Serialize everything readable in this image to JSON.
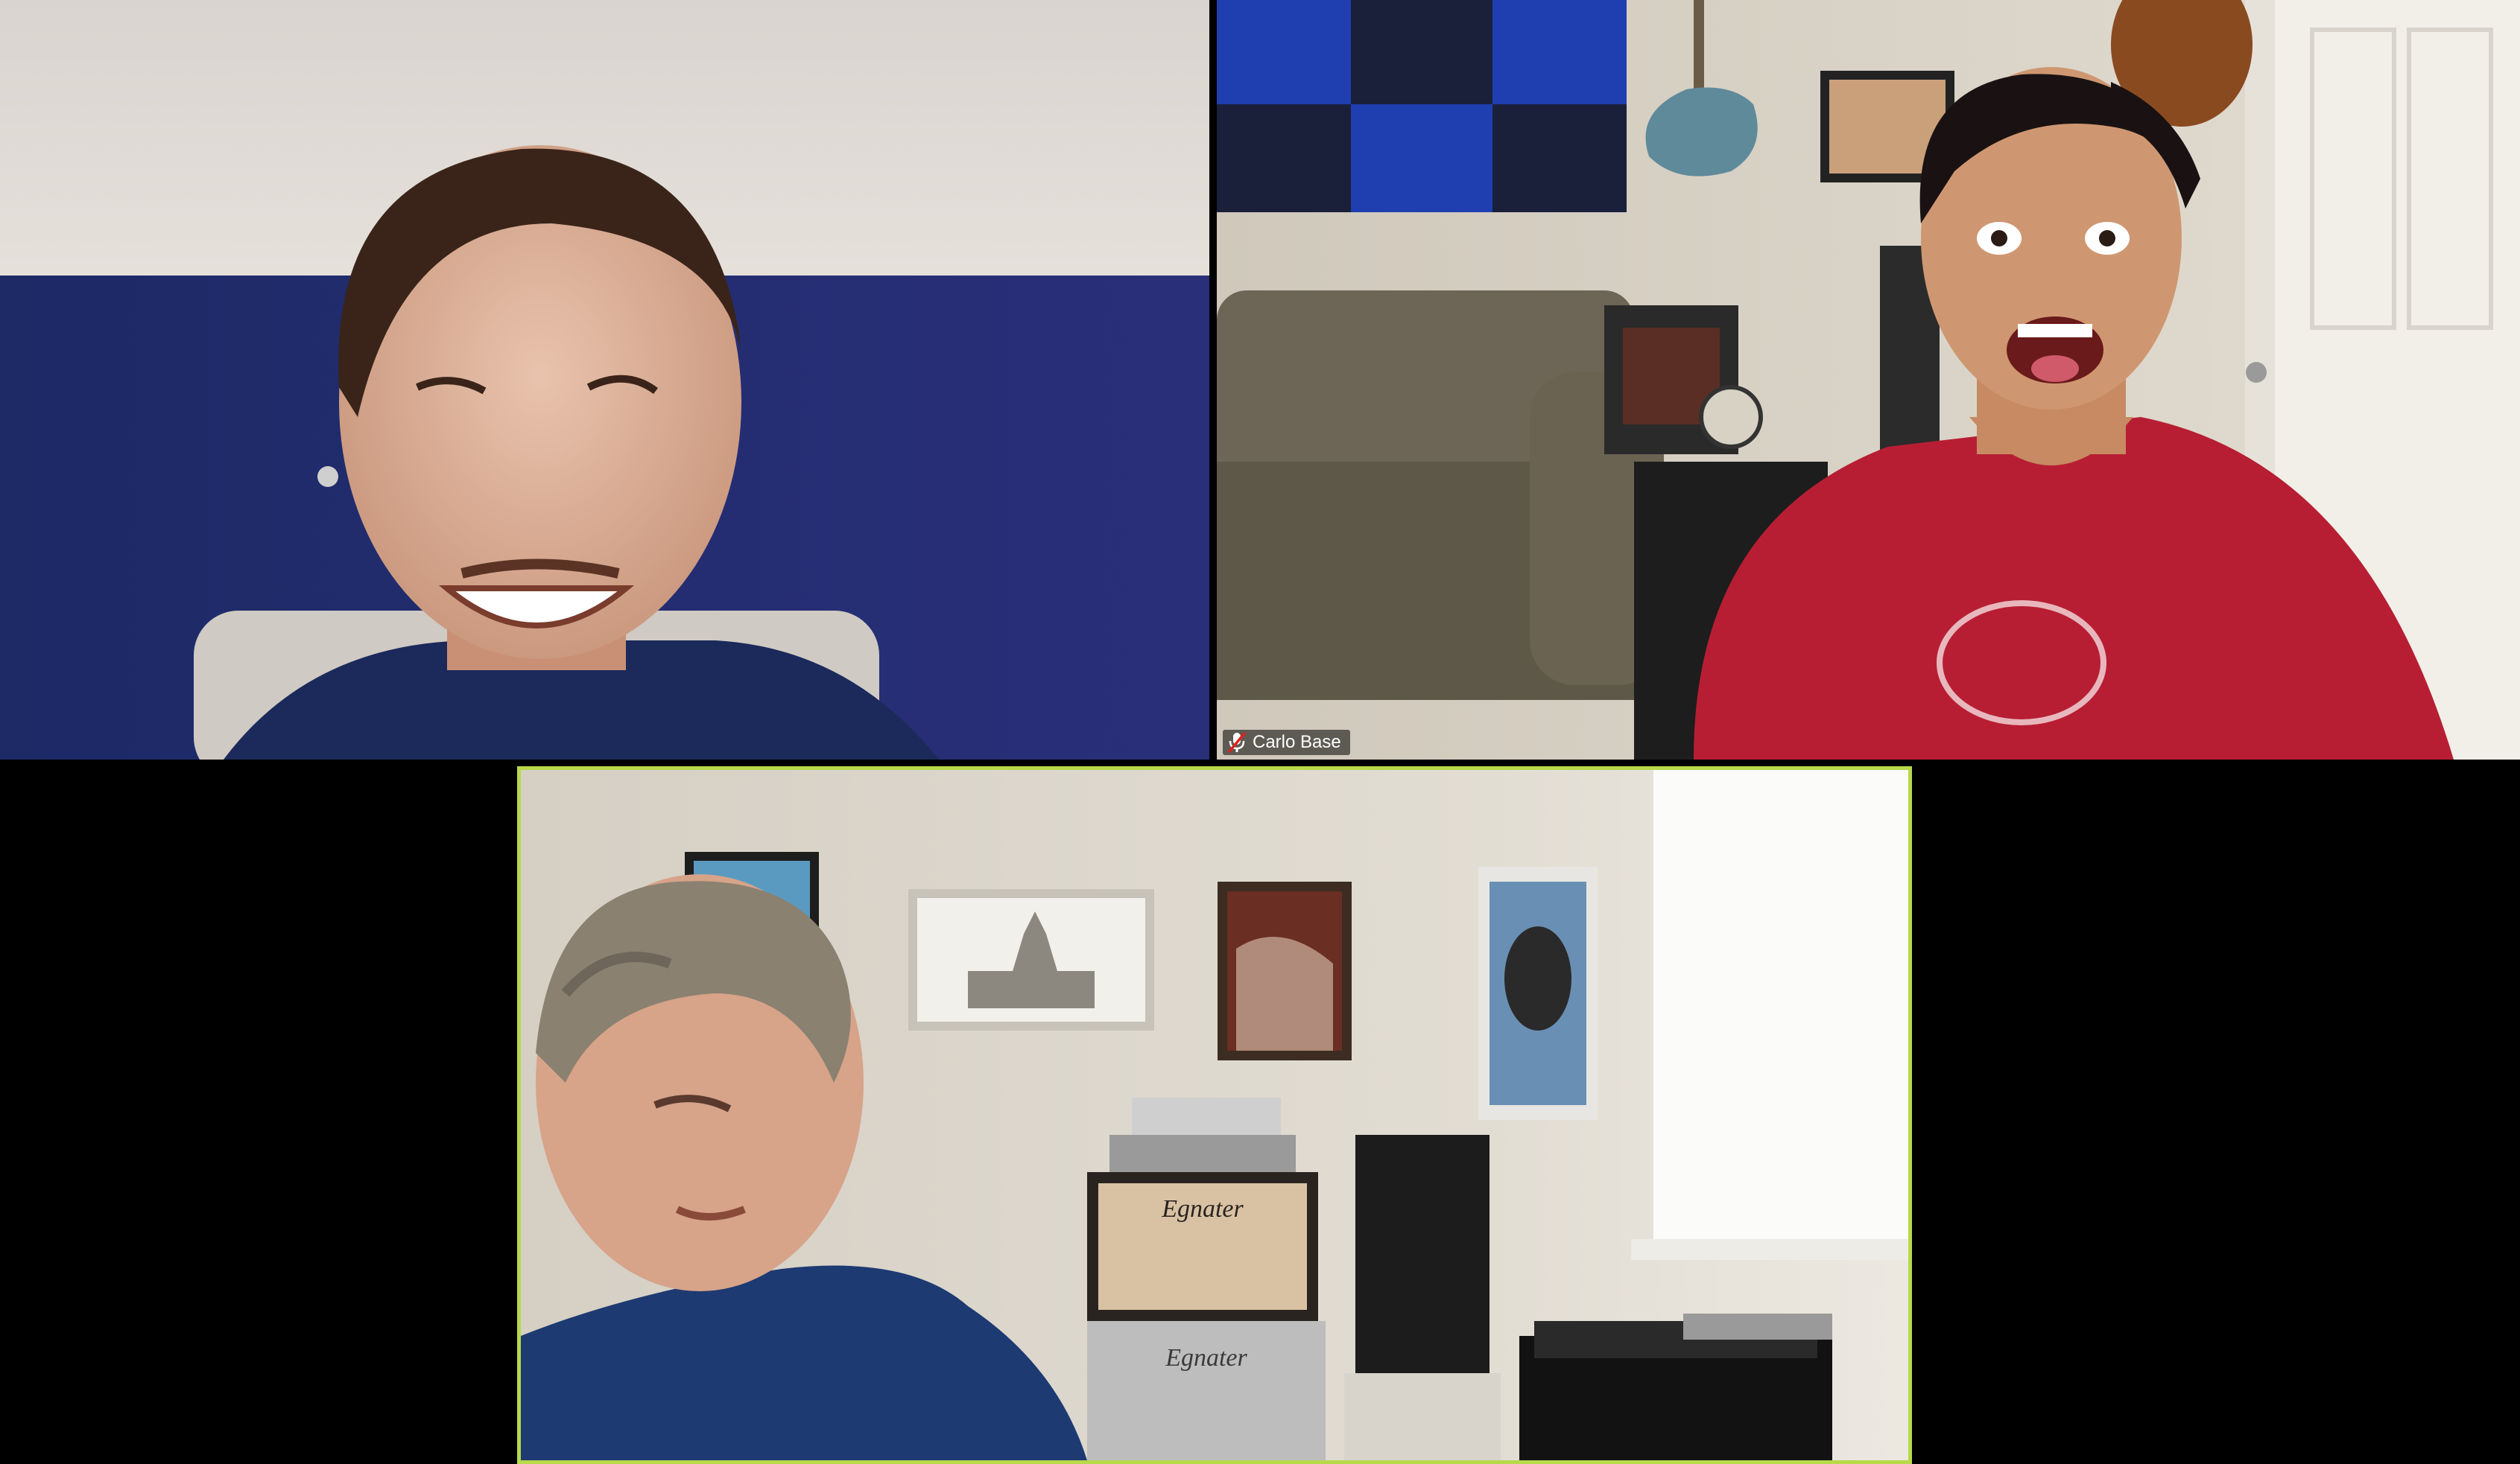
{
  "meeting": {
    "layout": "gallery-view",
    "active_speaker_border_color": "#b7d94a"
  },
  "participants": [
    {
      "id": "tile-1",
      "name": "",
      "muted": false,
      "name_visible": false
    },
    {
      "id": "tile-2",
      "name": "Carlo Base",
      "muted": true,
      "name_visible": true,
      "icon": "mic-muted-icon"
    },
    {
      "id": "tile-3",
      "name": "",
      "muted": false,
      "name_visible": false,
      "active_speaker": true
    }
  ],
  "scene_text": {
    "amp_brand_upper": "Egnater",
    "amp_brand_lower": "Egnater"
  },
  "colors": {
    "background": "#000000",
    "name_text": "#ffffff",
    "muted_icon": "#e02020"
  }
}
